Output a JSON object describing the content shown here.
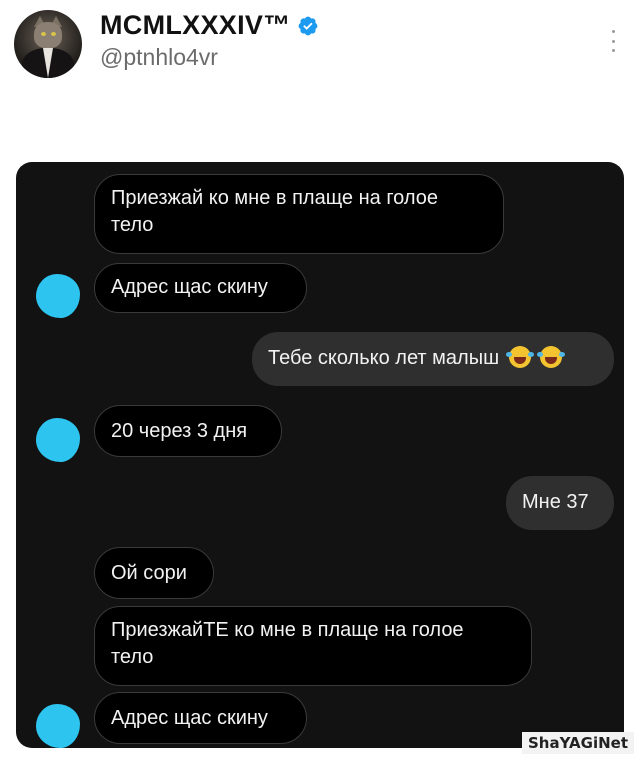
{
  "tweet": {
    "display_name": "MCMLXXXIV™",
    "handle": "@ptnhlo4vr",
    "verified_icon": "verified-badge-icon",
    "more_icon": "more-vertical-icon",
    "avatar": "cat-in-suit-avatar"
  },
  "chat": {
    "messages": [
      {
        "side": "in",
        "text_line1": "Приезжай ко мне в плаще на голое",
        "text_line2": "тело"
      },
      {
        "side": "in",
        "text": "Адрес щас скину"
      },
      {
        "side": "out",
        "text": "Тебе сколько лет малыш",
        "emoji": "😂😂"
      },
      {
        "side": "in",
        "text": "20 через 3 дня"
      },
      {
        "side": "out",
        "text": "Мне 37"
      },
      {
        "side": "in",
        "text": "Ой сори"
      },
      {
        "side": "in",
        "text_line1": "ПриезжайТЕ ко мне в плаще на голое",
        "text_line2": "тело"
      },
      {
        "side": "in",
        "text": "Адрес щас скину"
      }
    ],
    "bubble_in_color": "#000000",
    "bubble_out_color": "#2f2f2f",
    "background_color": "#121212",
    "redaction_color": "#2ec4f0"
  },
  "watermark": "ShaYAGiNet"
}
